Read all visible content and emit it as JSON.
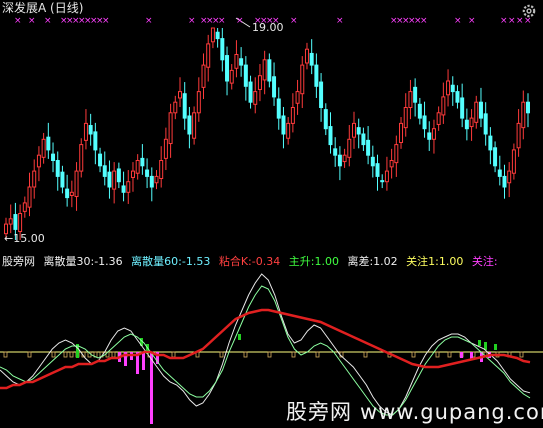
{
  "window": {
    "title": "深发展A (日线)"
  },
  "colors": {
    "background": "#000000",
    "up": "#ff3b3b",
    "down": "#54ffff",
    "ma_red": "#e02020",
    "line_white": "#e8e8e8",
    "line_green": "#8cffa0",
    "axis_yellow": "#ffff80",
    "magenta": "#ff40ff",
    "green_bar": "#22d022",
    "tan": "#d8b060"
  },
  "annotations": {
    "high_label": "19.00",
    "low_label": "←15.00"
  },
  "indicator_bar": {
    "name": "股旁网",
    "items": [
      {
        "label": "离散量30:",
        "value": "-1.36",
        "color": "#f0f0f0"
      },
      {
        "label": "离散量60:",
        "value": "-1.53",
        "color": "#6ff0ff"
      },
      {
        "label": "粘合K:",
        "value": "-0.34",
        "color": "#ff4040"
      },
      {
        "label": "主升:",
        "value": "1.00",
        "color": "#40ff40"
      },
      {
        "label": "离差:",
        "value": "1.02",
        "color": "#f0f0f0"
      },
      {
        "label": "关注1:",
        "value": "1.00",
        "color": "#ffff60"
      },
      {
        "label": "关注:",
        "value": "",
        "color": "#ff40ff"
      }
    ]
  },
  "watermark": {
    "text": "股旁网",
    "url": "www.gupang.com"
  },
  "chart_data": [
    {
      "type": "candlestick",
      "title": "深发展A (日线)",
      "price_high": 19.0,
      "price_low": 15.0,
      "closes": [
        15.3,
        15.4,
        15.2,
        15.5,
        15.7,
        16.0,
        16.3,
        16.6,
        16.9,
        16.7,
        16.5,
        16.2,
        16.0,
        15.8,
        15.9,
        16.3,
        16.8,
        17.2,
        17.0,
        16.7,
        16.4,
        16.2,
        16.0,
        16.3,
        16.1,
        15.9,
        16.1,
        16.3,
        16.5,
        16.4,
        16.2,
        16.0,
        16.2,
        16.5,
        16.9,
        17.4,
        17.6,
        17.8,
        17.3,
        17.0,
        17.4,
        17.8,
        18.3,
        18.7,
        19.0,
        18.8,
        18.4,
        18.0,
        18.2,
        18.5,
        18.3,
        17.9,
        17.6,
        17.8,
        18.1,
        18.4,
        18.0,
        17.7,
        17.3,
        17.0,
        17.2,
        17.5,
        17.8,
        18.3,
        18.6,
        18.3,
        17.9,
        17.5,
        17.1,
        16.8,
        16.6,
        16.4,
        16.6,
        16.9,
        17.2,
        17.0,
        16.8,
        16.6,
        16.4,
        16.2,
        16.1,
        16.3,
        16.5,
        16.8,
        17.2,
        17.5,
        17.8,
        17.6,
        17.3,
        17.1,
        16.9,
        17.1,
        17.4,
        17.7,
        18.0,
        17.8,
        17.6,
        17.3,
        17.1,
        17.3,
        17.6,
        17.3,
        17.0,
        16.7,
        16.4,
        16.2,
        16.0,
        16.3,
        16.7,
        17.2,
        17.6,
        17.4
      ]
    },
    {
      "type": "line",
      "series": [
        {
          "name": "离散量30",
          "values": [
            -0.6,
            -0.8,
            -1.0,
            -1.1,
            -1.0,
            -0.8,
            -0.5,
            -0.2,
            0.1,
            0.3,
            0.4,
            0.3,
            0.1,
            -0.2,
            -0.4,
            -0.3,
            0.0,
            0.4,
            0.7,
            0.8,
            0.7,
            0.4,
            0.1,
            -0.2,
            -0.5,
            -0.8,
            -1.0,
            -1.1,
            -1.3,
            -1.6,
            -1.8,
            -1.7,
            -1.4,
            -1.0,
            -0.4,
            0.3,
            0.9,
            1.4,
            1.9,
            2.3,
            2.6,
            2.4,
            1.9,
            1.2,
            0.6,
            0.3,
            0.4,
            0.7,
            0.9,
            0.8,
            0.5,
            0.2,
            -0.1,
            -0.3,
            -0.5,
            -0.8,
            -1.1,
            -1.5,
            -1.8,
            -2.0,
            -2.1,
            -1.9,
            -1.5,
            -1.0,
            -0.5,
            -0.1,
            0.2,
            0.4,
            0.5,
            0.6,
            0.6,
            0.5,
            0.3,
            0.2,
            0.1,
            -0.1,
            -0.3,
            -0.6,
            -0.9,
            -1.1,
            -1.3,
            -1.36
          ]
        },
        {
          "name": "离散量60",
          "values": [
            -0.5,
            -0.6,
            -0.8,
            -0.9,
            -1.0,
            -0.9,
            -0.7,
            -0.5,
            -0.3,
            -0.1,
            0.1,
            0.2,
            0.2,
            0.1,
            -0.1,
            -0.2,
            -0.1,
            0.1,
            0.3,
            0.5,
            0.6,
            0.5,
            0.3,
            0.0,
            -0.3,
            -0.6,
            -0.8,
            -1.0,
            -1.2,
            -1.4,
            -1.5,
            -1.5,
            -1.3,
            -1.0,
            -0.6,
            0.0,
            0.5,
            1.0,
            1.5,
            1.9,
            2.2,
            2.1,
            1.7,
            1.1,
            0.5,
            0.1,
            -0.1,
            0.0,
            0.2,
            0.3,
            0.2,
            0.0,
            -0.3,
            -0.6,
            -0.9,
            -1.2,
            -1.5,
            -1.8,
            -2.0,
            -2.1,
            -2.1,
            -1.9,
            -1.6,
            -1.2,
            -0.8,
            -0.4,
            -0.1,
            0.2,
            0.4,
            0.5,
            0.5,
            0.4,
            0.3,
            0.1,
            -0.1,
            -0.3,
            -0.5,
            -0.7,
            -1.0,
            -1.2,
            -1.4,
            -1.53
          ]
        },
        {
          "name": "粘合K",
          "values": [
            -1.2,
            -1.2,
            -1.1,
            -1.1,
            -1.0,
            -1.0,
            -0.9,
            -0.8,
            -0.7,
            -0.6,
            -0.5,
            -0.5,
            -0.4,
            -0.4,
            -0.4,
            -0.3,
            -0.3,
            -0.2,
            -0.2,
            -0.1,
            -0.1,
            -0.1,
            0.0,
            0.0,
            -0.1,
            -0.1,
            -0.2,
            -0.2,
            -0.2,
            -0.1,
            0.0,
            0.1,
            0.3,
            0.5,
            0.7,
            0.9,
            1.1,
            1.2,
            1.3,
            1.35,
            1.4,
            1.4,
            1.35,
            1.3,
            1.25,
            1.2,
            1.15,
            1.1,
            1.05,
            1.0,
            0.9,
            0.8,
            0.7,
            0.6,
            0.5,
            0.4,
            0.3,
            0.2,
            0.1,
            0.0,
            -0.1,
            -0.2,
            -0.3,
            -0.4,
            -0.45,
            -0.5,
            -0.5,
            -0.5,
            -0.45,
            -0.4,
            -0.35,
            -0.3,
            -0.25,
            -0.2,
            -0.15,
            -0.1,
            -0.1,
            -0.1,
            -0.15,
            -0.2,
            -0.3,
            -0.34
          ]
        }
      ]
    }
  ]
}
